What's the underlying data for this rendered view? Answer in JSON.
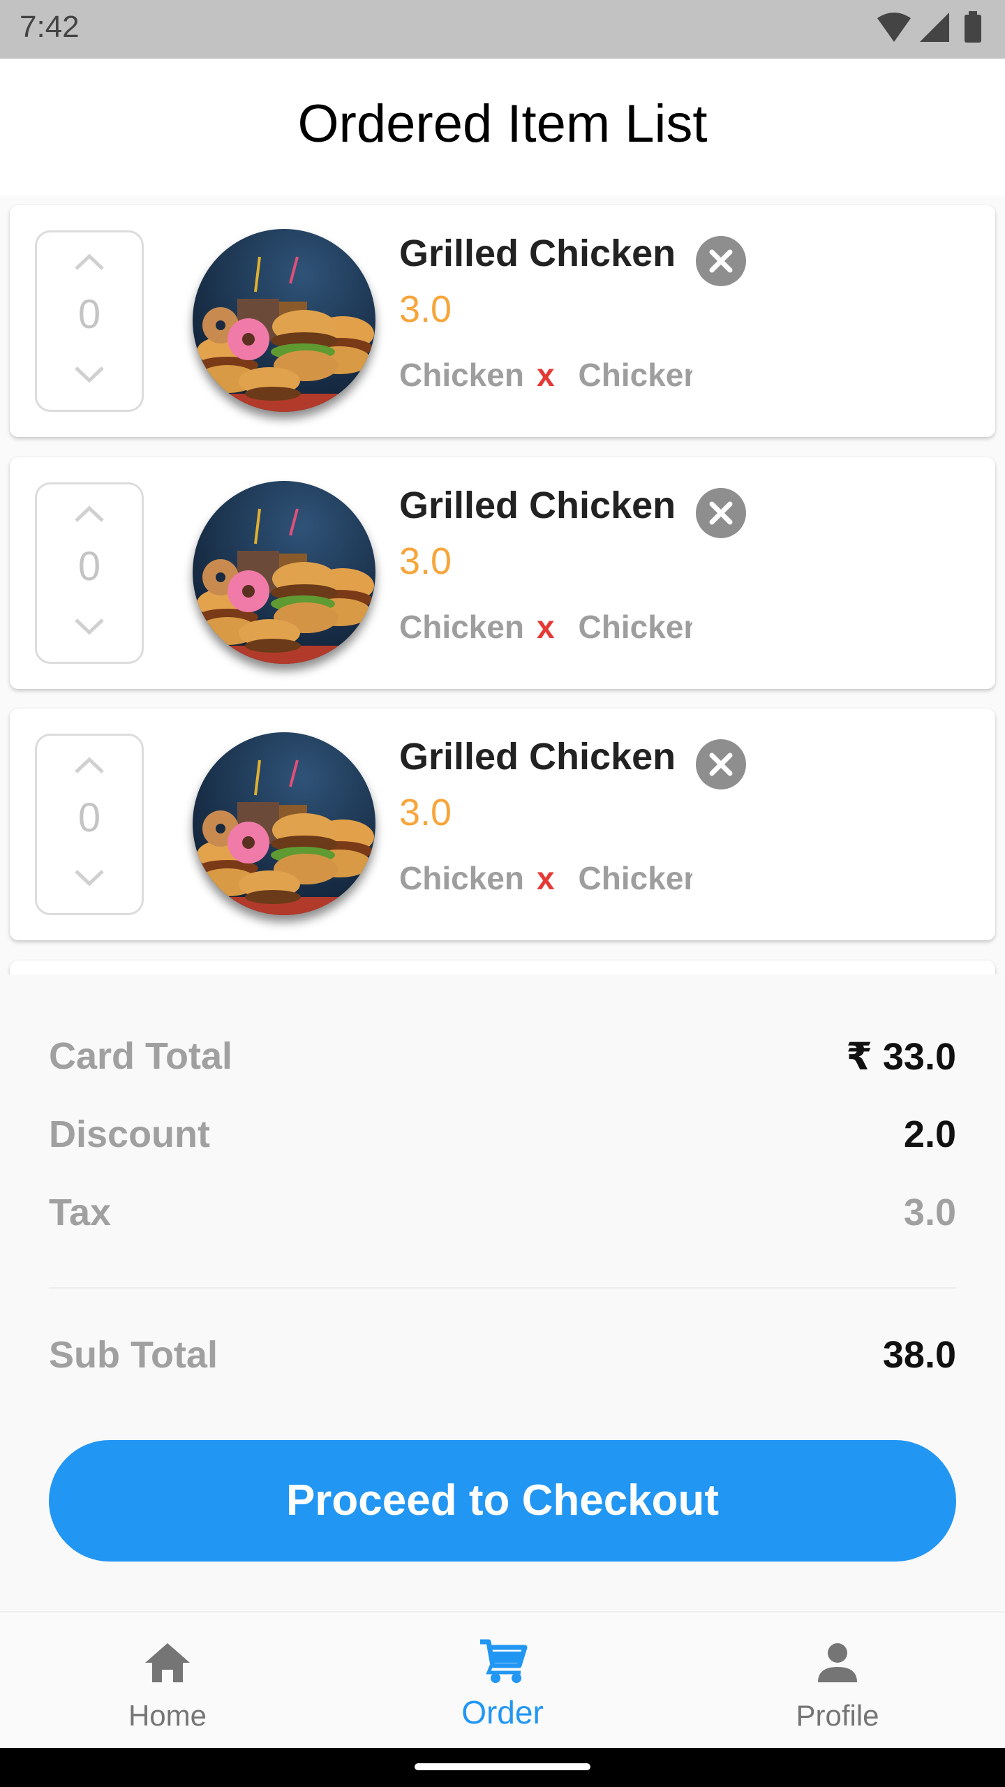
{
  "status_bar": {
    "time": "7:42"
  },
  "header": {
    "title": "Ordered Item List"
  },
  "items": [
    {
      "quantity": "0",
      "name": "Grilled Chicken",
      "price": "3.0",
      "tag1": "Chicken",
      "tag_separator": "x",
      "tag2": "Chicken"
    },
    {
      "quantity": "0",
      "name": "Grilled Chicken",
      "price": "3.0",
      "tag1": "Chicken",
      "tag_separator": "x",
      "tag2": "Chicken"
    },
    {
      "quantity": "0",
      "name": "Grilled Chicken",
      "price": "3.0",
      "tag1": "Chicken",
      "tag_separator": "x",
      "tag2": "Chicken"
    }
  ],
  "summary": {
    "card_total_label": "Card Total",
    "card_total_value": "₹ 33.0",
    "discount_label": "Discount",
    "discount_value": "2.0",
    "tax_label": "Tax",
    "tax_value": "3.0",
    "subtotal_label": "Sub Total",
    "subtotal_value": "38.0"
  },
  "checkout": {
    "label": "Proceed to Checkout"
  },
  "bottom_nav": [
    {
      "label": "Home",
      "icon": "home-icon"
    },
    {
      "label": "Order",
      "icon": "cart-icon",
      "active": true
    },
    {
      "label": "Profile",
      "icon": "person-icon"
    }
  ],
  "colors": {
    "accent": "#2196f3",
    "price": "#f7a53a",
    "remove": "#8e8e8e",
    "tag_separator": "#e53935"
  }
}
